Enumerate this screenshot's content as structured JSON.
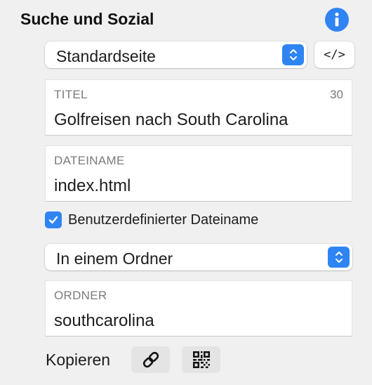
{
  "header": {
    "title": "Suche und Sozial",
    "info_icon": "info-icon"
  },
  "page_type": {
    "selected": "Standardseite",
    "code_button_label": "</>"
  },
  "title_field": {
    "label": "TITEL",
    "count": "30",
    "value": "Golfreisen nach South Carolina"
  },
  "filename_field": {
    "label": "DATEINAME",
    "value": "index.html"
  },
  "custom_filename": {
    "label": "Benutzerdefinierter Dateiname",
    "checked": true
  },
  "location": {
    "selected": "In einem Ordner"
  },
  "folder_field": {
    "label": "ORDNER",
    "value": "southcarolina"
  },
  "copy": {
    "label": "Kopieren",
    "link_icon": "link-icon",
    "qr_icon": "qr-code-icon"
  },
  "colors": {
    "accent": "#2f84f3",
    "background": "#f0f0f0",
    "secondary_text": "#7b7b7b"
  }
}
